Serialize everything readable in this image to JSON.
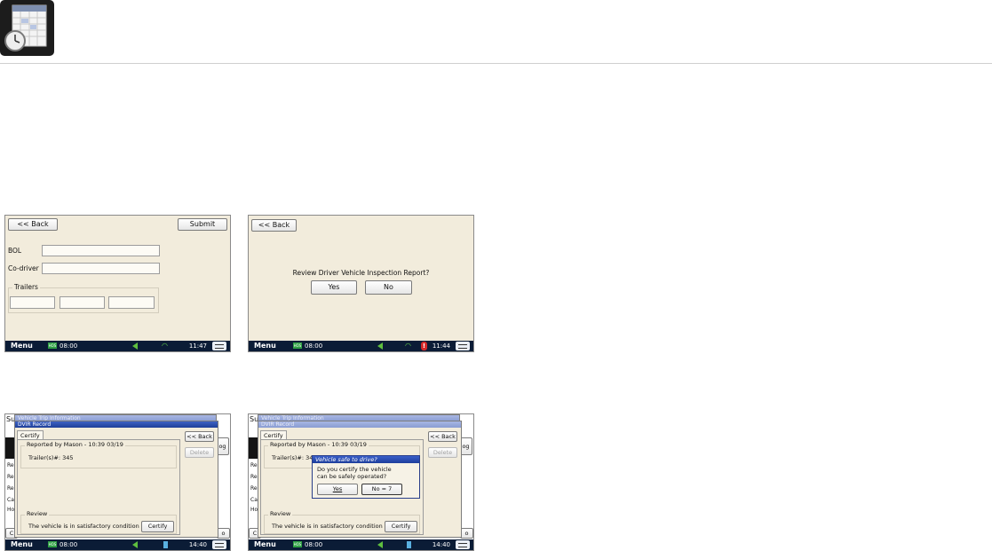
{
  "screen1": {
    "back": "<< Back",
    "submit": "Submit",
    "bol_label": "BOL",
    "codriver_label": "Co-driver",
    "trailers_label": "Trailers",
    "menu": "Menu",
    "hos_badge": "HOS",
    "hos_time": "08:00",
    "clock": "11:47"
  },
  "screen2": {
    "back": "<< Back",
    "question": "Review Driver Vehicle Inspection Report?",
    "yes": "Yes",
    "no": "No",
    "menu": "Menu",
    "hos_badge": "HOS",
    "hos_time": "08:00",
    "alert": "!",
    "clock": "11:44"
  },
  "screen3": {
    "bg_title": "Sum",
    "bg_window_title": "Vehicle Trip Information",
    "window_title": "DVIR Record",
    "tab": "Certify",
    "back": "<< Back",
    "delete": "Delete",
    "reported_by": "Reported by Mason - 10:39 03/19",
    "trailers": "Trailer(s)#: 345",
    "review_label": "Review",
    "review_text": "The vehicle is in satisfactory condition",
    "certify": "Certify",
    "side_btn": "og",
    "bg_rows": [
      "Re",
      "Re",
      "Re",
      "Ca",
      "Ho"
    ],
    "bottom_left": "C",
    "bottom_right": "o",
    "menu": "Menu",
    "hos_badge": "HOS",
    "hos_time": "08:00",
    "clock": "14:40"
  },
  "screen4": {
    "bg_title": "Sum",
    "bg_window_title": "Vehicle Trip Information",
    "window_title": "DVIR Record",
    "tab": "Certify",
    "back": "<< Back",
    "delete": "Delete",
    "reported_by": "Reported by Mason - 10:39 03/19",
    "trailers": "Trailer(s)#: 34",
    "review_label": "Review",
    "review_text": "The vehicle is in satisfactory condition",
    "certify": "Certify",
    "side_btn": "og",
    "bg_rows": [
      "Re",
      "Re",
      "Re",
      "Ca",
      "Ho"
    ],
    "bottom_left": "C",
    "bottom_right": "o",
    "dialog_title": "Vehicle safe to drive?",
    "dialog_line1": "Do you certify the vehicle",
    "dialog_line2": "can be safely operated?",
    "dialog_yes": "Yes",
    "dialog_no": "No = 7",
    "menu": "Menu",
    "hos_badge": "HOS",
    "hos_time": "08:00",
    "clock": "14:40"
  },
  "colors": {
    "screen_bg": "#f2ecdc",
    "taskbar": "#0b1c36",
    "title_blue": "#1f3f98",
    "status_green": "#2ea043",
    "alert_red": "#d62828"
  }
}
